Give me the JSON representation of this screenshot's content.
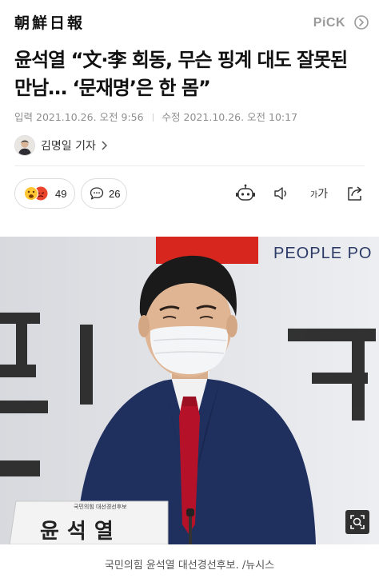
{
  "header": {
    "logo": "朝鮮日報",
    "pick_label": "PiCK"
  },
  "article": {
    "headline": "윤석열 “文·李 회동, 무슨 핑계 대도 잘못된 만남… ‘문재명’은 한 몸”",
    "published_label": "입력",
    "published": "2021.10.26. 오전 9:56",
    "modified_label": "수정",
    "modified": "2021.10.26. 오전 10:17",
    "author": "김명일 기자"
  },
  "reactions": {
    "count": "49",
    "comments_count": "26"
  },
  "toolbar": {
    "font_size_label_small": "가",
    "font_size_label_large": "가"
  },
  "photo": {
    "backdrop_text": "PEOPLE PO",
    "nameplate_top": "국민의힘 대선경선후보",
    "nameplate_name": "윤석열",
    "caption": "국민의힘 윤석열 대선경선후보. /뉴시스"
  },
  "colors": {
    "accent_red": "#d7261e",
    "suit_navy": "#1f2f5e",
    "text_gray": "#8e8e8e"
  }
}
